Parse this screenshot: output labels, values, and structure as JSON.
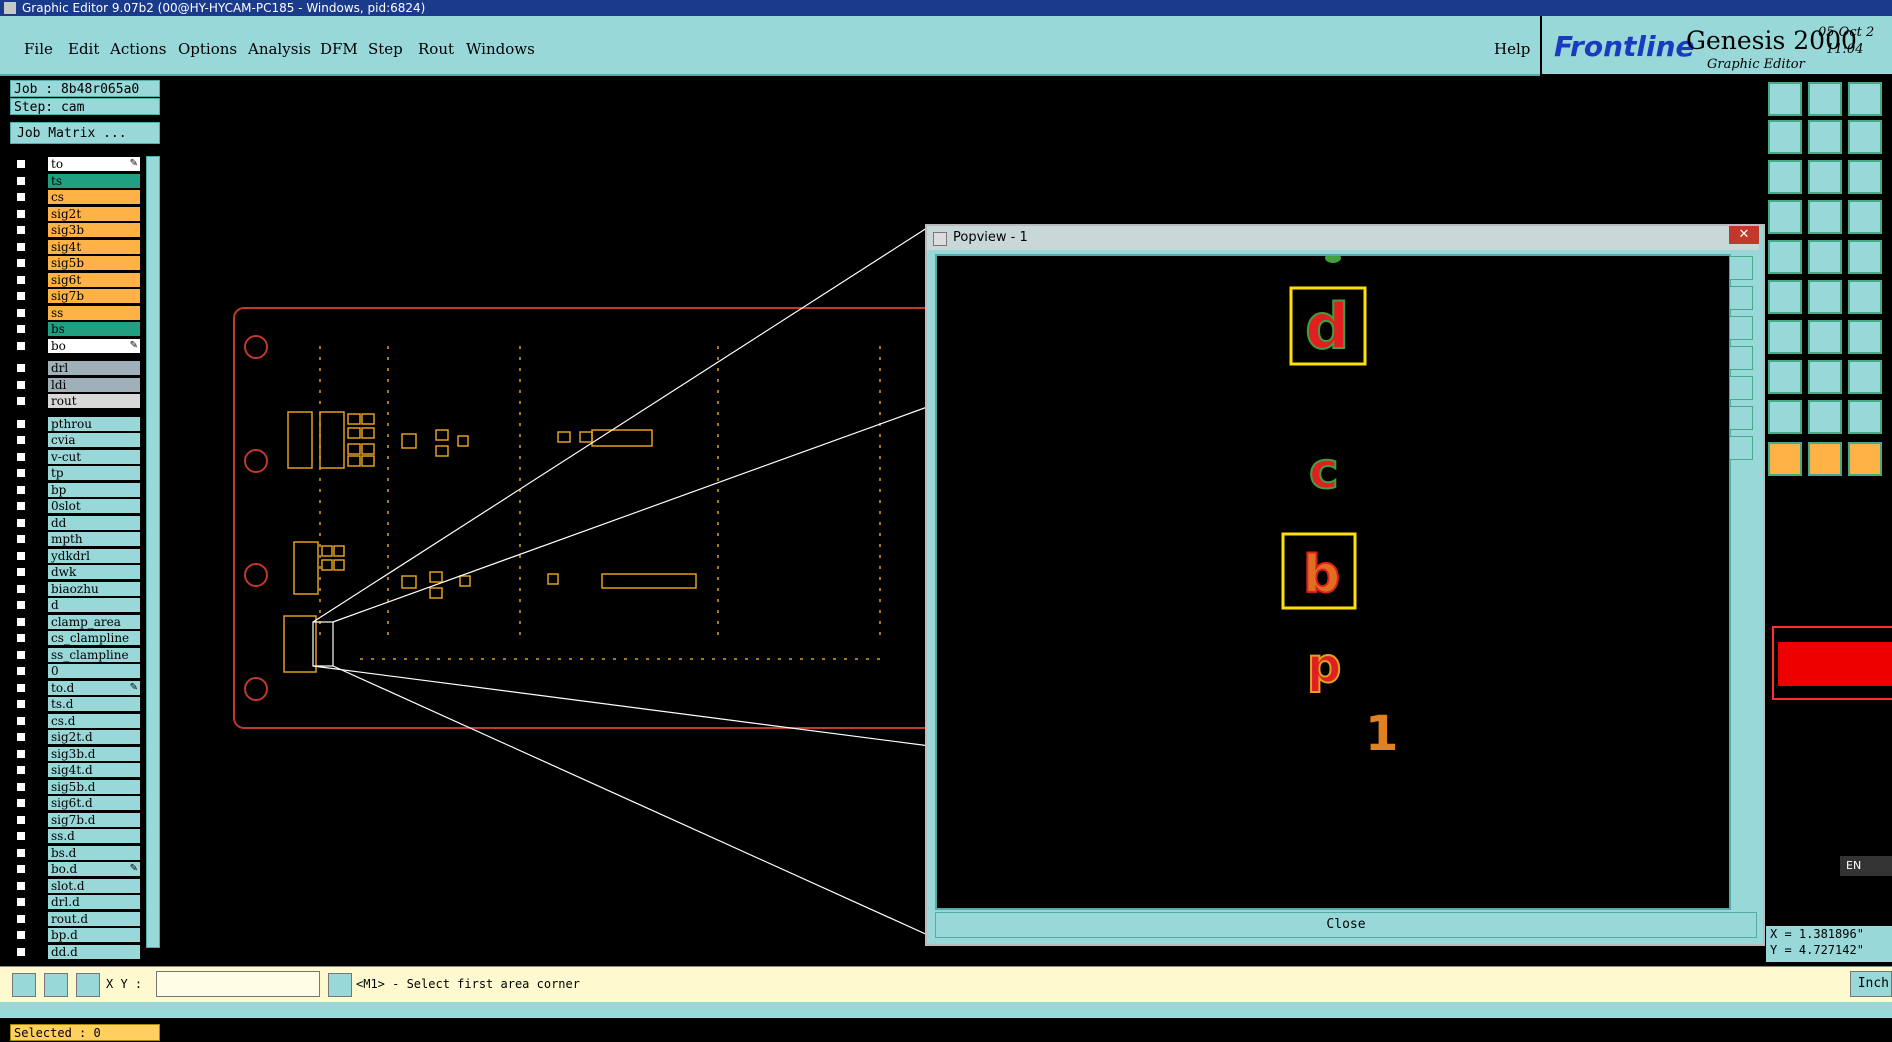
{
  "window_title": "Graphic Editor 9.07b2 (00@HY-HYCAM-PC185 - Windows, pid:6824)",
  "menu": [
    "File",
    "Edit",
    "Actions",
    "Options",
    "Analysis",
    "DFM",
    "Step",
    "Rout",
    "Windows"
  ],
  "help_label": "Help",
  "brand": {
    "logo": "Frontline",
    "product": "Genesis 2000",
    "subtitle": "Graphic Editor",
    "date": "05 Oct 2",
    "time": "11:04"
  },
  "job": {
    "job_label": "Job : 8b48r065a0",
    "step_label": "Step: cam",
    "matrix_button": "Job Matrix ..."
  },
  "layers": [
    {
      "name": "to",
      "color": "#ffffff",
      "mark": "✎"
    },
    {
      "name": "ts",
      "color": "#20a080",
      "mark": ""
    },
    {
      "name": "cs",
      "color": "#ffb347",
      "mark": ""
    },
    {
      "name": "sig2t",
      "color": "#ffb347",
      "mark": ""
    },
    {
      "name": "sig3b",
      "color": "#ffb347",
      "mark": ""
    },
    {
      "name": "sig4t",
      "color": "#ffb347",
      "mark": ""
    },
    {
      "name": "sig5b",
      "color": "#ffb347",
      "mark": ""
    },
    {
      "name": "sig6t",
      "color": "#ffb347",
      "mark": ""
    },
    {
      "name": "sig7b",
      "color": "#ffb347",
      "mark": ""
    },
    {
      "name": "ss",
      "color": "#ffb347",
      "mark": ""
    },
    {
      "name": "bs",
      "color": "#20a080",
      "mark": ""
    },
    {
      "name": "bo",
      "color": "#ffffff",
      "mark": "✎"
    },
    {
      "name": "drl",
      "color": "#a0b0b8",
      "mark": ""
    },
    {
      "name": "ldi",
      "color": "#a0b0b8",
      "mark": ""
    },
    {
      "name": "rout",
      "color": "#d8d8d8",
      "mark": ""
    },
    {
      "name": "pthrou",
      "color": "#98d8d8",
      "mark": ""
    },
    {
      "name": "cvia",
      "color": "#98d8d8",
      "mark": ""
    },
    {
      "name": "v-cut",
      "color": "#98d8d8",
      "mark": ""
    },
    {
      "name": "tp",
      "color": "#98d8d8",
      "mark": ""
    },
    {
      "name": "bp",
      "color": "#98d8d8",
      "mark": ""
    },
    {
      "name": "0slot",
      "color": "#98d8d8",
      "mark": ""
    },
    {
      "name": "dd",
      "color": "#98d8d8",
      "mark": ""
    },
    {
      "name": "mpth",
      "color": "#98d8d8",
      "mark": ""
    },
    {
      "name": "ydkdrl",
      "color": "#98d8d8",
      "mark": ""
    },
    {
      "name": "dwk",
      "color": "#98d8d8",
      "mark": ""
    },
    {
      "name": "biaozhu",
      "color": "#98d8d8",
      "mark": ""
    },
    {
      "name": "d",
      "color": "#98d8d8",
      "mark": ""
    },
    {
      "name": "clamp_area",
      "color": "#98d8d8",
      "mark": ""
    },
    {
      "name": "cs_clampline",
      "color": "#98d8d8",
      "mark": ""
    },
    {
      "name": "ss_clampline",
      "color": "#98d8d8",
      "mark": ""
    },
    {
      "name": "0",
      "color": "#98d8d8",
      "mark": ""
    },
    {
      "name": "to.d",
      "color": "#98d8d8",
      "mark": "✎"
    },
    {
      "name": "ts.d",
      "color": "#98d8d8",
      "mark": ""
    },
    {
      "name": "cs.d",
      "color": "#98d8d8",
      "mark": ""
    },
    {
      "name": "sig2t.d",
      "color": "#98d8d8",
      "mark": ""
    },
    {
      "name": "sig3b.d",
      "color": "#98d8d8",
      "mark": ""
    },
    {
      "name": "sig4t.d",
      "color": "#98d8d8",
      "mark": ""
    },
    {
      "name": "sig5b.d",
      "color": "#98d8d8",
      "mark": ""
    },
    {
      "name": "sig6t.d",
      "color": "#98d8d8",
      "mark": ""
    },
    {
      "name": "sig7b.d",
      "color": "#98d8d8",
      "mark": ""
    },
    {
      "name": "ss.d",
      "color": "#98d8d8",
      "mark": ""
    },
    {
      "name": "bs.d",
      "color": "#98d8d8",
      "mark": ""
    },
    {
      "name": "bo.d",
      "color": "#98d8d8",
      "mark": "✎"
    },
    {
      "name": "slot.d",
      "color": "#98d8d8",
      "mark": ""
    },
    {
      "name": "drl.d",
      "color": "#98d8d8",
      "mark": ""
    },
    {
      "name": "rout.d",
      "color": "#98d8d8",
      "mark": ""
    },
    {
      "name": "bp.d",
      "color": "#98d8d8",
      "mark": ""
    },
    {
      "name": "dd.d",
      "color": "#98d8d8",
      "mark": ""
    }
  ],
  "selected_label": "Selected : 0",
  "popview": {
    "title": "Popview - 1",
    "close_label": "Close",
    "close_x": "✕",
    "glyphs": [
      "d",
      "c",
      "b",
      "p",
      "1"
    ]
  },
  "coords": {
    "x": "X = 1.381896\"",
    "y": "Y = 4.727142\""
  },
  "status": {
    "xy_label": "X Y :",
    "xy_value": "",
    "prompt": "<M1> - Select first area corner",
    "units": "Inch"
  },
  "tray": {
    "lang": "EN"
  },
  "colors": {
    "accent": "#98d8d8",
    "layer_orange": "#ffb347",
    "layer_green": "#20a080",
    "pcb_outline": "#c0392b",
    "highlight": "#ffe000"
  }
}
